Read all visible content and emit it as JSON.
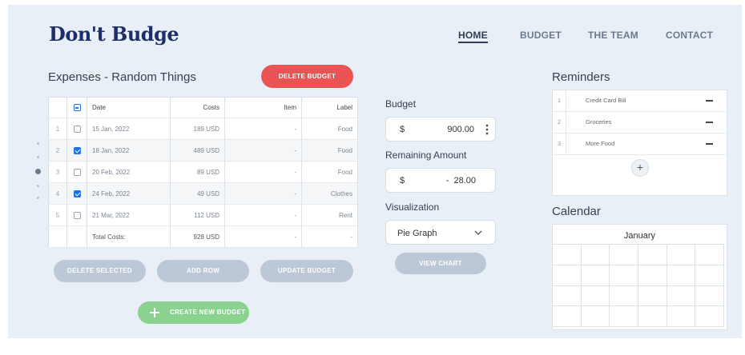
{
  "app": {
    "title": "Don't Budge"
  },
  "nav": {
    "items": [
      "HOME",
      "BUDGET",
      "THE TEAM",
      "CONTACT"
    ],
    "active": "HOME"
  },
  "expenses": {
    "title": "Expenses - Random Things",
    "delete_budget_label": "DELETE BUDGET",
    "columns": [
      "Date",
      "Costs",
      "Item",
      "Label"
    ],
    "rows": [
      {
        "index": "1",
        "checked": false,
        "date": "15 Jan, 2022",
        "cost": "189 USD",
        "item": "-",
        "label": "Food"
      },
      {
        "index": "2",
        "checked": true,
        "date": "18 Jan, 2022",
        "cost": "489 USD",
        "item": "-",
        "label": "Food"
      },
      {
        "index": "3",
        "checked": false,
        "date": "20 Feb, 2022",
        "cost": "89 USD",
        "item": "-",
        "label": "Food"
      },
      {
        "index": "4",
        "checked": true,
        "date": "24 Feb, 2022",
        "cost": "49 USD",
        "item": "-",
        "label": "Clothes"
      },
      {
        "index": "5",
        "checked": false,
        "date": "21 Mar, 2022",
        "cost": "112 USD",
        "item": "-",
        "label": "Rent"
      }
    ],
    "total": {
      "label": "Total Costs:",
      "cost": "928 USD",
      "item": "-",
      "label_col": "-"
    },
    "buttons": {
      "delete_selected": "DELETE SELECTED",
      "add_row": "ADD ROW",
      "update_budget": "UPDATE BUDGET",
      "create_new": "CREATE NEW BUDGET"
    }
  },
  "budget": {
    "label": "Budget",
    "currency": "$",
    "value": "900.00",
    "remaining_label": "Remaining Amount",
    "remaining_currency": "$",
    "remaining_value": "-  28.00",
    "visualization_label": "Visualization",
    "visualization_value": "Pie Graph",
    "view_chart_label": "VIEW CHART"
  },
  "reminders": {
    "title": "Reminders",
    "items": [
      {
        "index": "1",
        "text": "Credit Card Bill"
      },
      {
        "index": "2",
        "text": "Groceries"
      },
      {
        "index": "3",
        "text": "More Food"
      }
    ],
    "add_symbol": "+"
  },
  "calendar": {
    "title": "Calendar",
    "month": "January"
  },
  "colors": {
    "brand": "#1c2f6b",
    "danger": "#ea5455",
    "success": "#8bd18f",
    "muted_button": "#bcc8d6",
    "checkbox": "#1a73e8"
  },
  "icons": [
    "plus-icon",
    "chevron-down-icon",
    "kebab-menu-icon",
    "minus-icon",
    "checkbox-icon"
  ]
}
